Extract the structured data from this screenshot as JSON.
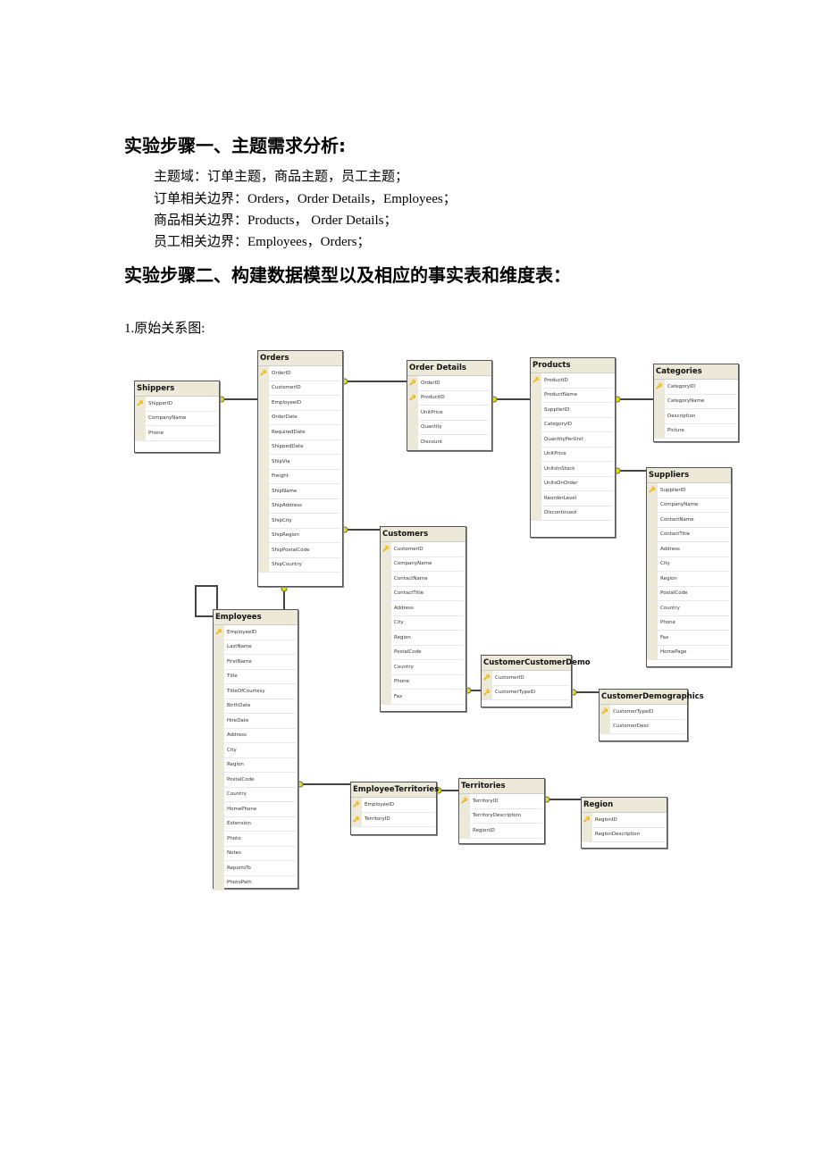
{
  "heading1": "实验步骤一、主题需求分析:",
  "lines": [
    "主题域：订单主题，商品主题，员工主题；",
    "订单相关边界：Orders，Order Details，Employees；",
    "商品相关边界：Products，  Order Details；",
    "员工相关边界：Employees，Orders；"
  ],
  "heading2": "实验步骤二、构建数据模型以及相应的事实表和维度表：",
  "caption": "1.原始关系图:",
  "colors": {
    "header": "#ece9d8",
    "key": "#c8b400",
    "connector": "#e8e000"
  },
  "tables": [
    {
      "name": "Shippers",
      "pk": 1,
      "fields": [
        "ShipperID",
        "CompanyName",
        "Phone"
      ]
    },
    {
      "name": "Orders",
      "pk": 1,
      "fields": [
        "OrderID",
        "CustomerID",
        "EmployeeID",
        "OrderDate",
        "RequiredDate",
        "ShippedDate",
        "ShipVia",
        "Freight",
        "ShipName",
        "ShipAddress",
        "ShipCity",
        "ShipRegion",
        "ShipPostalCode",
        "ShipCountry"
      ]
    },
    {
      "name": "Order Details",
      "pk": 2,
      "fields": [
        "OrderID",
        "ProductID",
        "UnitPrice",
        "Quantity",
        "Discount"
      ]
    },
    {
      "name": "Products",
      "pk": 1,
      "fields": [
        "ProductID",
        "ProductName",
        "SupplierID",
        "CategoryID",
        "QuantityPerUnit",
        "UnitPrice",
        "UnitsInStock",
        "UnitsOnOrder",
        "ReorderLevel",
        "Discontinued"
      ]
    },
    {
      "name": "Categories",
      "pk": 1,
      "fields": [
        "CategoryID",
        "CategoryName",
        "Description",
        "Picture"
      ]
    },
    {
      "name": "Suppliers",
      "pk": 1,
      "fields": [
        "SupplierID",
        "CompanyName",
        "ContactName",
        "ContactTitle",
        "Address",
        "City",
        "Region",
        "PostalCode",
        "Country",
        "Phone",
        "Fax",
        "HomePage"
      ]
    },
    {
      "name": "Customers",
      "pk": 1,
      "fields": [
        "CustomerID",
        "CompanyName",
        "ContactName",
        "ContactTitle",
        "Address",
        "City",
        "Region",
        "PostalCode",
        "Country",
        "Phone",
        "Fax"
      ]
    },
    {
      "name": "Employees",
      "pk": 1,
      "fields": [
        "EmployeeID",
        "LastName",
        "FirstName",
        "Title",
        "TitleOfCourtesy",
        "BirthDate",
        "HireDate",
        "Address",
        "City",
        "Region",
        "PostalCode",
        "Country",
        "HomePhone",
        "Extension",
        "Photo",
        "Notes",
        "ReportsTo",
        "PhotoPath"
      ]
    },
    {
      "name": "CustomerCustomerDemo",
      "pk": 2,
      "fields": [
        "CustomerID",
        "CustomerTypeID"
      ]
    },
    {
      "name": "CustomerDemographics",
      "pk": 1,
      "fields": [
        "CustomerTypeID",
        "CustomerDesc"
      ]
    },
    {
      "name": "EmployeeTerritories",
      "pk": 2,
      "fields": [
        "EmployeeID",
        "TerritoryID"
      ]
    },
    {
      "name": "Territories",
      "pk": 1,
      "fields": [
        "TerritoryID",
        "TerritoryDescription",
        "RegionID"
      ]
    },
    {
      "name": "Region",
      "pk": 1,
      "fields": [
        "RegionID",
        "RegionDescription"
      ]
    }
  ]
}
